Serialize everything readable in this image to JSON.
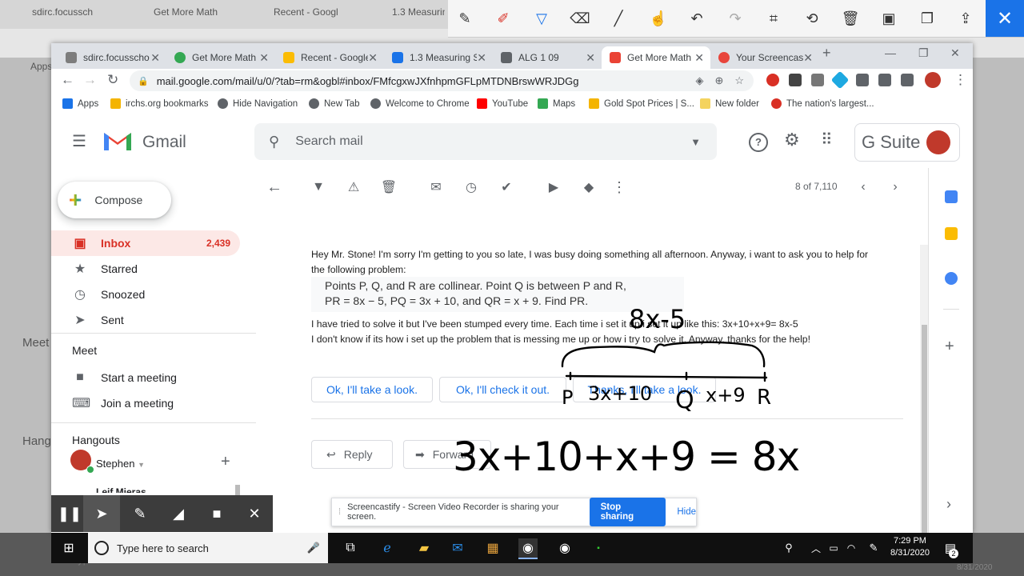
{
  "background_window": {
    "tabs": [
      "sdirc.focussch",
      "Get More Math",
      "Recent - Googl",
      "1.3 Measurin"
    ],
    "address": "mail.google.com/mail/u/0/?tab=rm&ogbl#inbox/FMfcgxwJXfnhpmGFLpMTDNBrswWRJDGg",
    "apps": "Apps",
    "meet": "Meet",
    "hangouts": "Hang",
    "taskbar_search": "Type here to search",
    "date": "8/31/2020"
  },
  "annotation_toolbar": {
    "tools": [
      "pen",
      "highlighter",
      "marker",
      "eraser",
      "line",
      "pointer",
      "undo",
      "redo",
      "crop",
      "history",
      "delete",
      "save",
      "copy",
      "share"
    ],
    "close": "✕"
  },
  "browser": {
    "tabs": [
      {
        "title": "sdirc.focusscho",
        "color": "#7d7d7d"
      },
      {
        "title": "Get More Math",
        "color": "#34a853"
      },
      {
        "title": "Recent - Google",
        "color": "#fbbc04"
      },
      {
        "title": "1.3 Measuring S",
        "color": "#1a73e8"
      },
      {
        "title": "ALG 1 09",
        "color": "#5f6368"
      },
      {
        "title": "Get More Math",
        "color": "#ea4335"
      },
      {
        "title": "Your Screencast",
        "color": "#e8453c"
      }
    ],
    "new_tab": "+",
    "url": "mail.google.com/mail/u/0/?tab=rm&ogbl#inbox/FMfcgxwJXfnhpmGFLpMTDNBrswWRJDGg",
    "bookmarks": [
      {
        "label": "Apps",
        "color": "#1a73e8"
      },
      {
        "label": "irchs.org bookmarks",
        "color": "#f4b400"
      },
      {
        "label": "Hide Navigation",
        "color": "#5f6368"
      },
      {
        "label": "New Tab",
        "color": "#5f6368"
      },
      {
        "label": "Welcome to Chrome",
        "color": "#5f6368"
      },
      {
        "label": "YouTube",
        "color": "#ff0000"
      },
      {
        "label": "Maps",
        "color": "#34a853"
      },
      {
        "label": "Gold Spot Prices | S...",
        "color": "#f4b400"
      },
      {
        "label": "New folder",
        "color": "#f4d35e"
      },
      {
        "label": "The nation's largest...",
        "color": "#d93025"
      }
    ]
  },
  "gmail": {
    "logo_text": "Gmail",
    "search_placeholder": "Search mail",
    "gsuite": "G Suite",
    "compose": "Compose",
    "nav": [
      {
        "label": "Inbox",
        "count": "2,439",
        "icon": "inbox-icon",
        "active": true
      },
      {
        "label": "Starred",
        "count": "",
        "icon": "star-icon"
      },
      {
        "label": "Snoozed",
        "count": "",
        "icon": "clock-icon"
      },
      {
        "label": "Sent",
        "count": "",
        "icon": "send-icon"
      }
    ],
    "meet_title": "Meet",
    "meet_items": [
      "Start a meeting",
      "Join a meeting"
    ],
    "hangouts_title": "Hangouts",
    "hangouts_user": "Stephen",
    "hangouts_next": "Leif Mieras",
    "pagination": "8 of 7,110",
    "email": {
      "line1": "Hey Mr. Stone! I'm sorry I'm getting to you so late, I was busy doing something all afternoon. Anyway, i want to ask you to help for",
      "line2": "the following problem:",
      "quote1": "Points P, Q, and R are collinear. Point Q is between P and R,",
      "quote2": "PR = 8x − 5, PQ = 3x + 10, and QR = x + 9. Find PR.",
      "line3": "I have tried to solve it but I've been stumped every time. Each time i set it up i set it up like this: 3x+10+x+9= 8x-5",
      "line4": "I don't know if its how i set up the problem that is messing me up or how i try to solve it. Anyway, thanks for the help!"
    },
    "smart_replies": [
      "Ok, I'll take a look.",
      "Ok, I'll check it out.",
      "Thanks, I'll take a look."
    ],
    "reply": "Reply",
    "forward": "Forward"
  },
  "screencastify": {
    "message": "Screencastify - Screen Video Recorder is sharing your screen.",
    "stop": "Stop sharing",
    "hide": "Hide"
  },
  "taskbar": {
    "search": "Type here to search",
    "time": "7:29 PM",
    "date": "8/31/2020",
    "notifications": "2"
  },
  "handwriting": {
    "top": "8x-5",
    "p": "P",
    "pq": "3x+10",
    "q": "Q",
    "qr": "x+9",
    "r": "R",
    "equation": "3x+10+x+9 = 8x"
  }
}
